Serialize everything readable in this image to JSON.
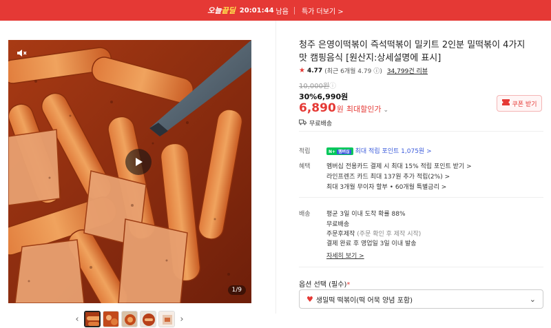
{
  "topbar": {
    "brand_a": "오늘",
    "brand_b": "끝딜",
    "countdown": "20:01:44",
    "remain_label": "남음",
    "more_link": "특가 더보기 >"
  },
  "gallery": {
    "counter": "1/9",
    "prev_arrow": "‹",
    "next_arrow": "›",
    "thumb_count": 5
  },
  "product": {
    "title": "청주 은영이떡볶이 즉석떡볶이 밀키트 2인분 밀떡볶이 4가지맛 캠핑음식 [원산지:상세설명에 표시]",
    "rating": "4.77",
    "rating_detail": "(최근 6개월 4.79",
    "rating_info": "ⓘ)",
    "review_link": "34,799건 리뷰",
    "original_price": "10,000원",
    "discount_rate": "30%",
    "sale_price": "6,990원",
    "final_price": "6,890",
    "final_won": "원",
    "final_label": "최대할인가",
    "coupon_button": "쿠폰 받기",
    "shipping_badge": "무료배송"
  },
  "benefits": {
    "point_label": "적립",
    "npay_badge": "N+",
    "npay_badge2": "멤버십",
    "point_text": "최대 적립 포인트 1,075원 >",
    "benefit_label": "혜택",
    "benefit_lines": [
      "멤버십 전용카드 결제 시 최대 15% 적립 포인트 받기 >",
      "라인프렌즈 카드 최대 137원 추가 적립(2%) >",
      "최대 3개월 무이자 할부 • 60개월 특별금리 >"
    ]
  },
  "delivery": {
    "label": "배송",
    "lines": [
      "평균 3일 이내 도착 확률 88%",
      "무료배송",
      "주문후제작",
      "결제 완료 후 영업일 3일 이내 발송"
    ],
    "custom_note": "(주문 확인 후 제작 시작)",
    "detail_link": "자세히 보기 >"
  },
  "option": {
    "label": "옵션 선택 (필수)",
    "required_mark": "*",
    "selected": "생밀떡 떡볶이(떡 어묵 양념 포함)"
  },
  "colors": {
    "accent": "#e53935",
    "link_blue": "#3b5bdb",
    "npay_green": "#03c75a"
  }
}
